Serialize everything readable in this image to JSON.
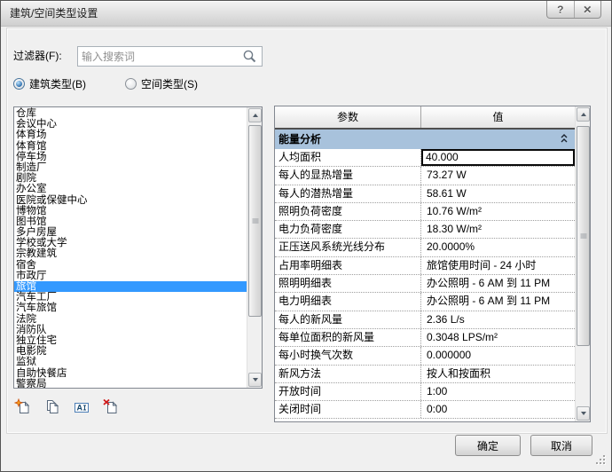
{
  "window": {
    "title": "建筑/空间类型设置",
    "help_glyph": "?",
    "close_glyph": "✕"
  },
  "filter": {
    "label": "过滤器(F):",
    "placeholder": "输入搜索词",
    "icon": "search-icon"
  },
  "type_radios": [
    {
      "label": "建筑类型(B)",
      "selected": true
    },
    {
      "label": "空间类型(S)",
      "selected": false
    }
  ],
  "type_list": {
    "selected_index": 16,
    "selected_item": "旅馆",
    "items": [
      "仓库",
      "会议中心",
      "体育场",
      "体育馆",
      "停车场",
      "制造厂",
      "剧院",
      "办公室",
      "医院或保健中心",
      "博物馆",
      "图书馆",
      "多户房屋",
      "学校或大学",
      "宗教建筑",
      "宿舍",
      "市政厅",
      "旅馆",
      "汽车工厂",
      "汽车旅馆",
      "法院",
      "消防队",
      "独立住宅",
      "电影院",
      "监狱",
      "自助快餐店",
      "警察局"
    ]
  },
  "list_toolbar": [
    {
      "icon": "new-type-icon"
    },
    {
      "icon": "duplicate-type-icon"
    },
    {
      "icon": "rename-type-icon"
    },
    {
      "icon": "delete-type-icon"
    }
  ],
  "table": {
    "columns": [
      "参数",
      "值"
    ],
    "section_label": "能量分析",
    "rows": [
      {
        "param": "人均面积",
        "value": "40.000",
        "editing": true
      },
      {
        "param": "每人的显热增量",
        "value": "73.27 W"
      },
      {
        "param": "每人的潜热增量",
        "value": "58.61 W"
      },
      {
        "param": "照明负荷密度",
        "value": "10.76 W/m²"
      },
      {
        "param": "电力负荷密度",
        "value": "18.30 W/m²"
      },
      {
        "param": "正压送风系统光线分布",
        "value": "20.0000%"
      },
      {
        "param": "占用率明细表",
        "value": "旅馆使用时间 - 24 小时"
      },
      {
        "param": "照明明细表",
        "value": "办公照明 - 6 AM 到 11 PM"
      },
      {
        "param": "电力明细表",
        "value": "办公照明 - 6 AM 到 11 PM"
      },
      {
        "param": "每人的新风量",
        "value": "2.36 L/s"
      },
      {
        "param": "每单位面积的新风量",
        "value": "0.3048 LPS/m²"
      },
      {
        "param": "每小时换气次数",
        "value": "0.000000"
      },
      {
        "param": "新风方法",
        "value": "按人和按面积"
      },
      {
        "param": "开放时间",
        "value": "1:00"
      },
      {
        "param": "关闭时间",
        "value": "0:00"
      }
    ]
  },
  "buttons": {
    "ok": "确定",
    "cancel": "取消"
  },
  "colors": {
    "selection_blue": "#3399ff",
    "section_header_bg": "#a8c2dc",
    "dialog_bg": "#f0f0f0"
  }
}
